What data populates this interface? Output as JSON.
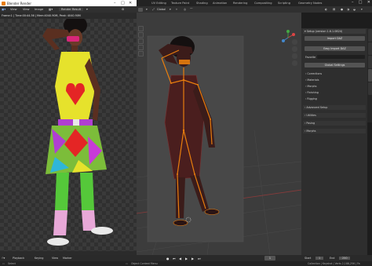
{
  "render_window": {
    "title": "Blender Render",
    "menu": [
      "View",
      "View",
      "Image"
    ],
    "slot_label": "Render Result",
    "info_line": "Frame:1 | Time:00:44.56 | Mem:4040.90M, Peak: 4040.90M"
  },
  "main_window": {
    "workspace_tabs": [
      "UV Editing",
      "Texture Paint",
      "Shading",
      "Animation",
      "Rendering",
      "Compositing",
      "Scripting",
      "Geometry Nodes"
    ],
    "viewport_header": {
      "orientation_label": "Global"
    }
  },
  "sidebar": {
    "setup_header": "Setup (version 1.6.1.0824)",
    "import_daz": "Import DAZ",
    "easy_import_daz": "Easy Import DAZ",
    "favorite_label": "Favorite",
    "global_settings": "Global Settings",
    "subpanels": [
      "Corrections",
      "Materials",
      "Morphs",
      "Finishing",
      "Rigging"
    ],
    "sections": [
      "Advanced Setup",
      "Utilities",
      "Posing",
      "Morphs"
    ]
  },
  "timeline": {
    "menu": [
      "Playback",
      "Keying",
      "View",
      "Marker"
    ],
    "current_frame": "1",
    "start_label": "Start",
    "start_value": "1",
    "end_label": "End",
    "end_value": "250"
  },
  "statusbar": {
    "left": "Select",
    "middle": "Object Context Menu",
    "right": "Collection | Keyshot | Verts 2,188,256 | Fa"
  },
  "colors": {
    "accent_orange": "#e87d0d",
    "viewport_bg": "#3c3c3c",
    "panel_bg": "#2e2e2e"
  }
}
